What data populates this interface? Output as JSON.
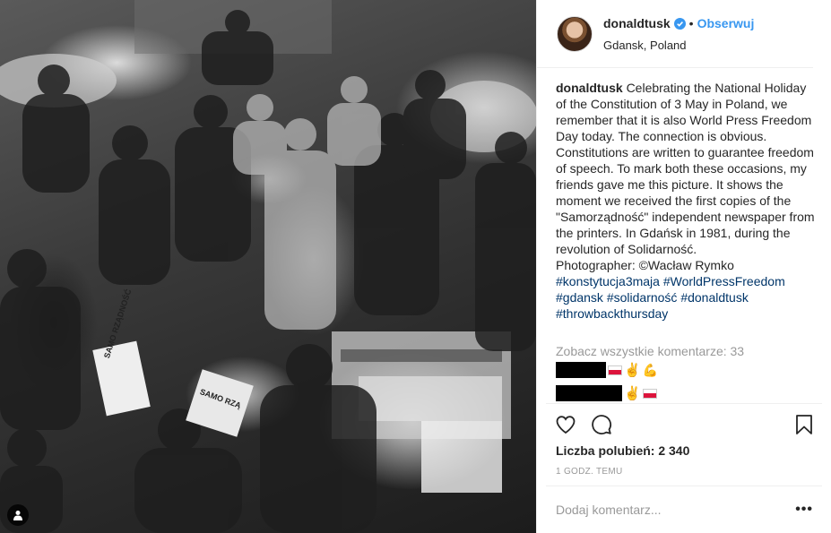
{
  "post": {
    "username": "donaldtusk",
    "follow_label": "Obserwuj",
    "location": "Gdansk, Poland",
    "caption_text": "Celebrating the National Holiday of the Constitution of 3 May in Poland, we remember that it is also World Press Freedom Day today. The connection is obvious. Constitutions are written to guarantee freedom of speech. To mark both these occasions, my friends gave me this picture. It shows the moment we received the first copies of the \"Samorządność\" independent newspaper from the printers. In Gdańsk in 1981, during the revolution of Solidarność.",
    "caption_photographer": "Photographer: ©Wacław Rymko",
    "hashtags": [
      "#konstytucja3maja",
      "#WorldPressFreedom",
      "#gdansk",
      "#solidarność",
      "#donaldtusk",
      "#throwbackthursday"
    ],
    "view_comments_label": "Zobacz wszystkie komentarze: 33",
    "likes_label": "Liczba polubień: 2 340",
    "time_label": "1 GODZ. TEMU",
    "comment_placeholder": "Dodaj komentarz...",
    "more_label": "•••"
  },
  "photo": {
    "sign_1": "SAMO RZĄDNOŚĆ",
    "sign_2": "SAMO RZĄ"
  },
  "icons": {
    "verified": "verified-badge-icon",
    "heart": "heart-icon",
    "comment": "comment-icon",
    "bookmark": "bookmark-icon",
    "tag": "user-tag-icon"
  },
  "colors": {
    "link": "#003569",
    "follow": "#3897f0",
    "muted": "#999999"
  }
}
